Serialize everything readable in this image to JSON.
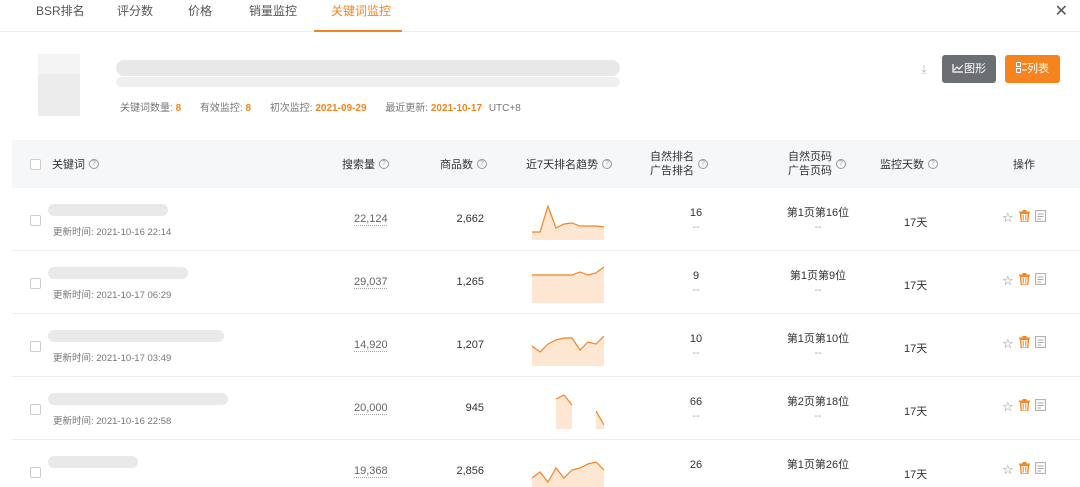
{
  "tabs": [
    {
      "label": "BSR排名",
      "active": false
    },
    {
      "label": "评分数",
      "active": false
    },
    {
      "label": "价格",
      "active": false
    },
    {
      "label": "销量监控",
      "active": false
    },
    {
      "label": "关键词监控",
      "active": true
    }
  ],
  "close_label": "✕",
  "summary": {
    "keyword_count_label": "关键词数量:",
    "keyword_count": "8",
    "valid_label": "有效监控:",
    "valid_count": "8",
    "first_label": "初次监控:",
    "first_date": "2021-09-29",
    "last_label": "最近更新:",
    "last_date": "2021-10-17",
    "tz": "UTC+8"
  },
  "toolbar": {
    "download_icon": "⤓",
    "chart_label": "图形",
    "list_label": "列表",
    "chart_icon": "chart-line-icon",
    "list_icon": "list-icon"
  },
  "columns": {
    "keyword": "关键词",
    "search": "搜索量",
    "goods": "商品数",
    "trend": "近7天排名趋势",
    "natural_rank": "自然排名",
    "ad_rank": "广告排名",
    "natural_page": "自然页码",
    "ad_page": "广告页码",
    "days": "监控天数",
    "ops": "操作"
  },
  "accent_color": "#f5841f",
  "rows": [
    {
      "updated": "更新时间: 2021-10-16 22:14",
      "search": "22,124",
      "goods": "2,662",
      "natural_rank": "16",
      "ad_rank": "--",
      "natural_page": "第1页第16位",
      "ad_page": "--",
      "days": "17天",
      "trend": [
        8,
        8,
        34,
        12,
        16,
        17,
        14,
        14,
        14,
        13
      ]
    },
    {
      "updated": "更新时间: 2021-10-17 06:29",
      "search": "29,037",
      "goods": "1,265",
      "natural_rank": "9",
      "ad_rank": "--",
      "natural_page": "第1页第9位",
      "ad_page": "--",
      "days": "17天",
      "trend": [
        28,
        28,
        28,
        28,
        28,
        28,
        31,
        28,
        30,
        36
      ]
    },
    {
      "updated": "更新时间: 2021-10-17 03:49",
      "search": "14,920",
      "goods": "1,207",
      "natural_rank": "10",
      "ad_rank": "--",
      "natural_page": "第1页第10位",
      "ad_page": "--",
      "days": "17天",
      "trend": [
        20,
        14,
        22,
        26,
        28,
        28,
        16,
        24,
        22,
        30
      ]
    },
    {
      "updated": "更新时间: 2021-10-16 22:58",
      "search": "20,000",
      "goods": "945",
      "natural_rank": "66",
      "ad_rank": "--",
      "natural_page": "第2页第18位",
      "ad_page": "--",
      "days": "17天",
      "trend": [
        null,
        null,
        null,
        30,
        34,
        24,
        null,
        null,
        18,
        4
      ]
    },
    {
      "updated": "",
      "search": "19,368",
      "goods": "2,856",
      "natural_rank": "26",
      "ad_rank": "",
      "natural_page": "第1页第26位",
      "ad_page": "",
      "days": "17天",
      "trend": [
        14,
        20,
        10,
        24,
        14,
        22,
        24,
        28,
        30,
        22
      ]
    }
  ]
}
